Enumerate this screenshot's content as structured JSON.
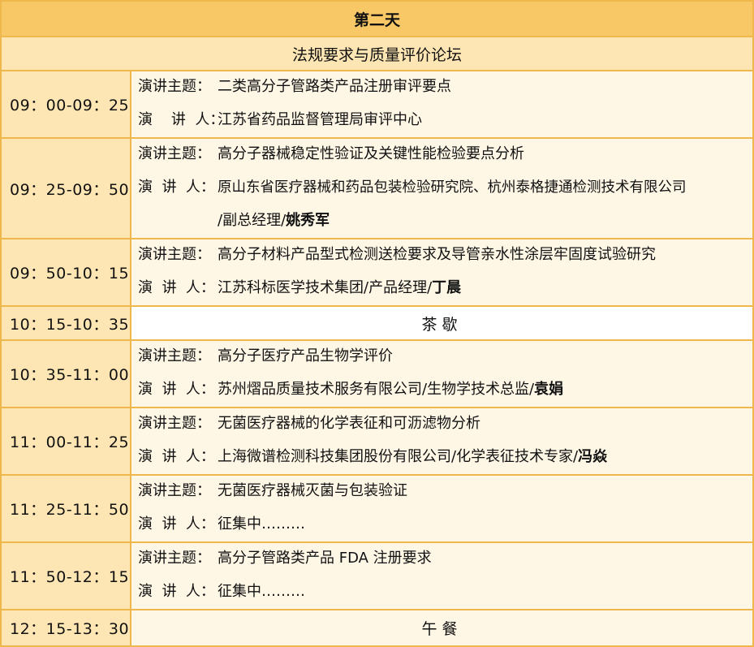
{
  "day_title": "第二天",
  "forum_title": "法规要求与质量评价论坛",
  "labels": {
    "topic": "演讲主题：",
    "speaker_first": "演    讲  人：",
    "speaker": "演  讲  人："
  },
  "sessions": [
    {
      "time": "09：00-09：25",
      "topic": "二类高分子管路类产品注册审评要点",
      "speaker": "江苏省药品监督管理局审评中心",
      "name": ""
    },
    {
      "time": "09：25-09：50",
      "topic": "高分子器械稳定性验证及关键性能检验要点分析",
      "speaker": "原山东省医疗器械和药品包装检验研究院、杭州泰格捷通检测技术有限公司",
      "speaker_cont": "/副总经理/",
      "name": "姚秀军"
    },
    {
      "time": "09：50-10：15",
      "topic": "高分子材料产品型式检测送检要求及导管亲水性涂层牢固度试验研究",
      "speaker": "江苏科标医学技术集团/产品经理/",
      "name": "丁晨"
    },
    {
      "time": "10：15-10：35",
      "break": "茶歇"
    },
    {
      "time": "10：35-11：00",
      "topic": "高分子医疗产品生物学评价",
      "speaker": "苏州熠品质量技术服务有限公司/生物学技术总监/",
      "name": "袁娟"
    },
    {
      "time": "11：00-11：25",
      "topic": "无菌医疗器械的化学表征和可沥滤物分析",
      "speaker": "上海微谱检测科技集团股份有限公司/化学表征技术专家/",
      "name": "冯焱"
    },
    {
      "time": "11：25-11：50",
      "topic": "无菌医疗器械灭菌与包装验证",
      "speaker": "征集中………",
      "name": ""
    },
    {
      "time": "11：50-12：15",
      "topic": "高分子管路类产品 FDA 注册要求",
      "speaker": "征集中………",
      "name": ""
    },
    {
      "time": "12：15-13：30",
      "break": "午餐"
    }
  ]
}
